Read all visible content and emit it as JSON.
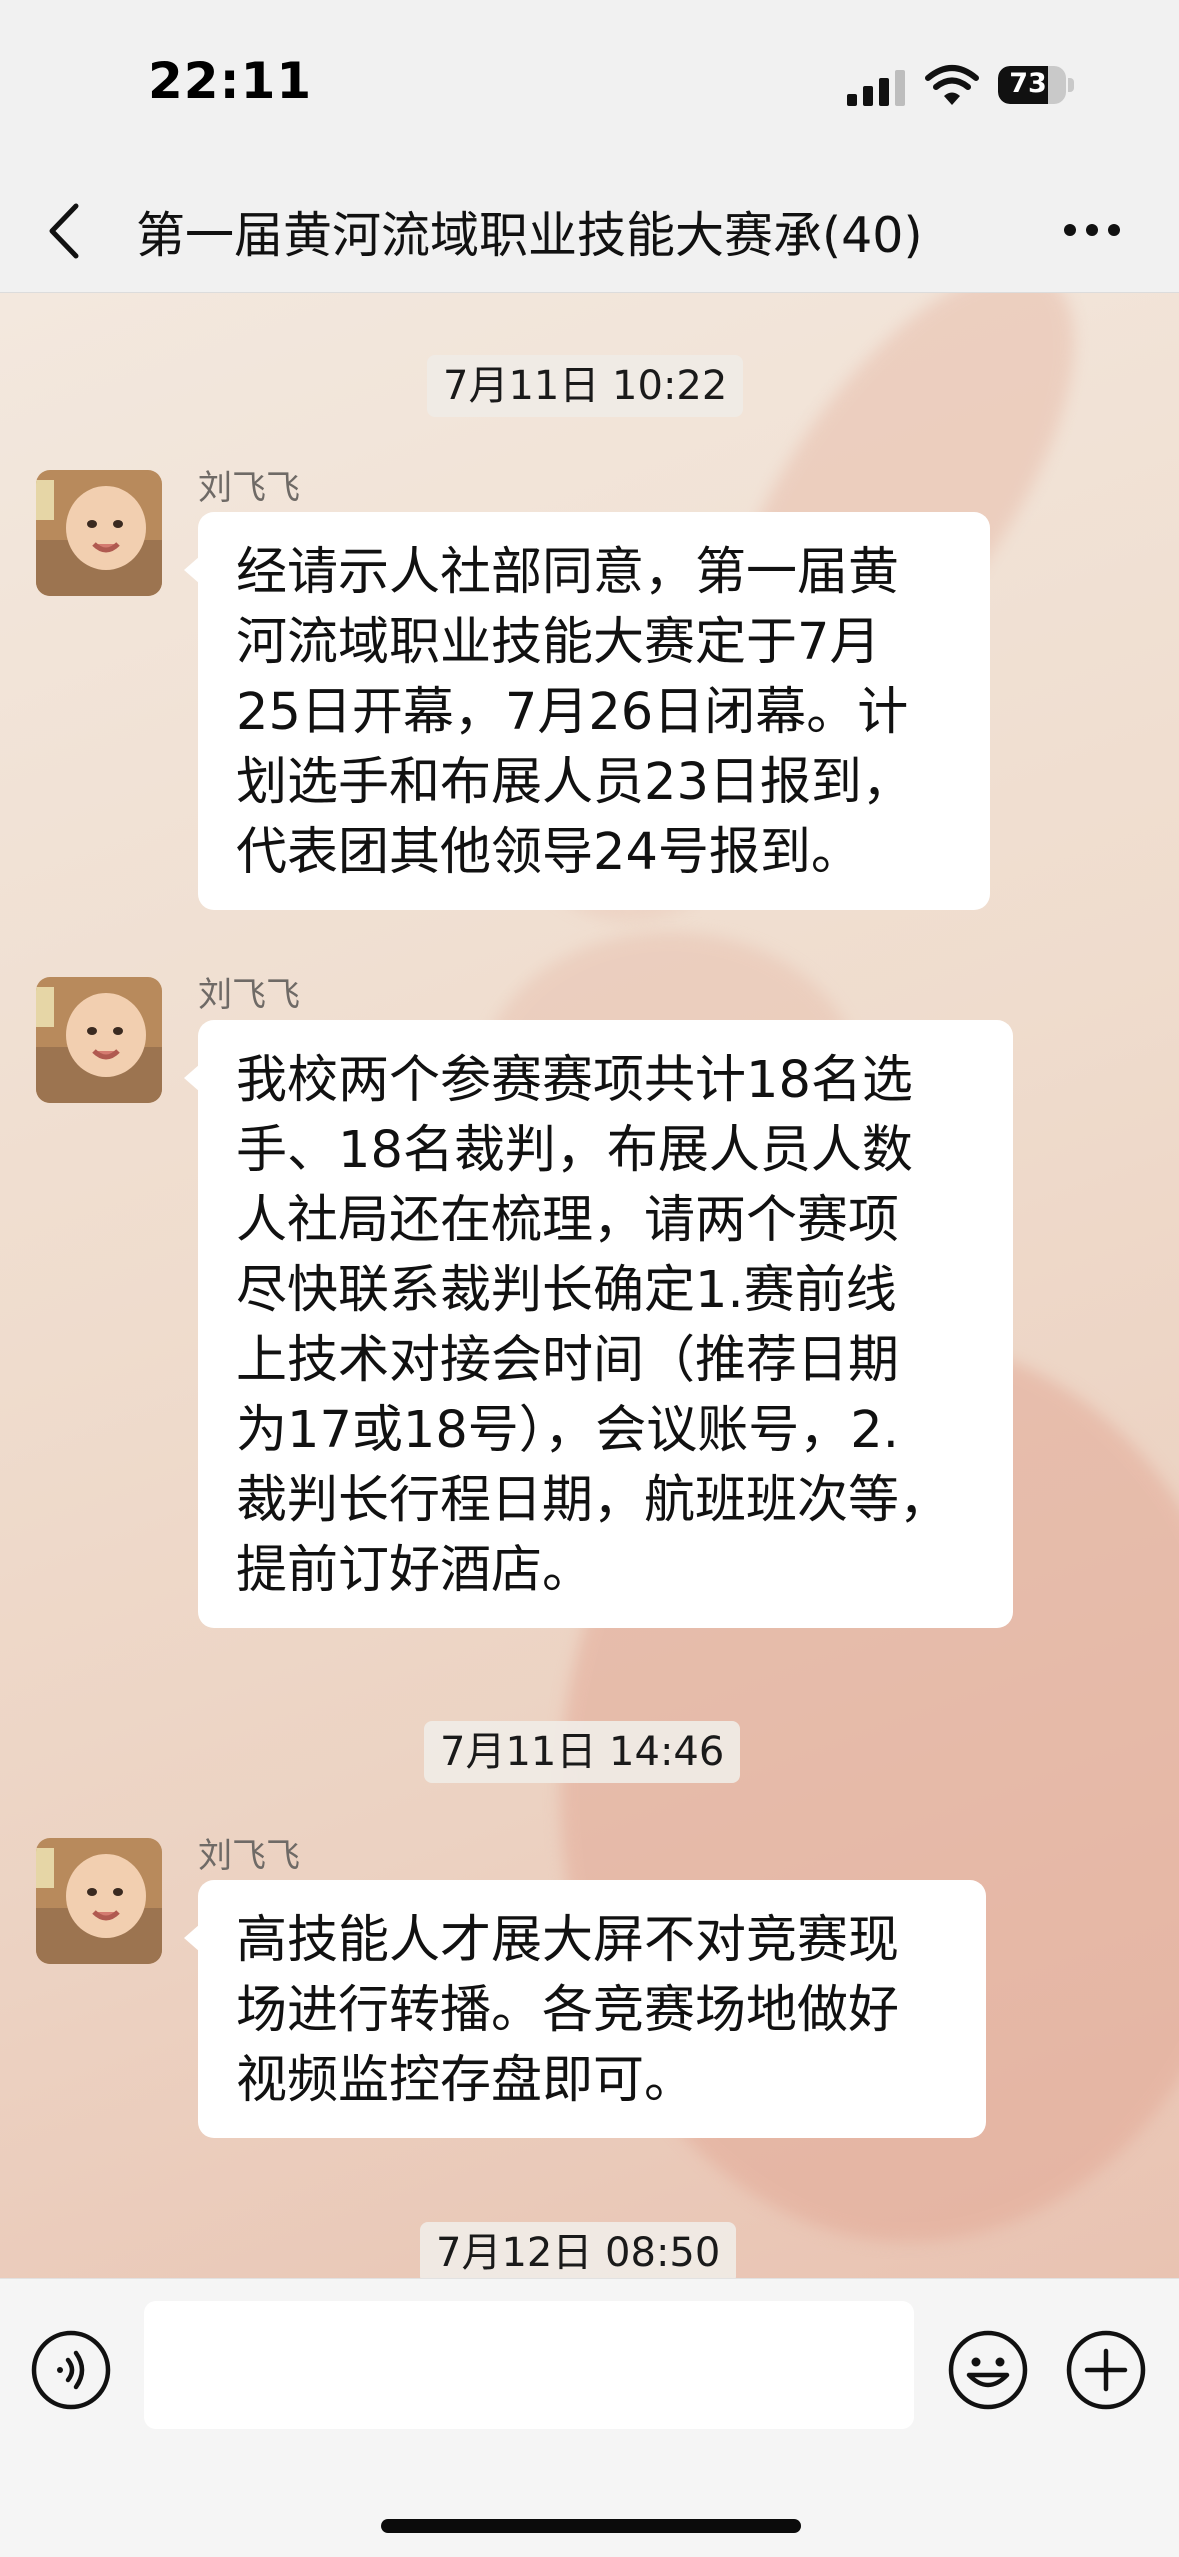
{
  "status_bar": {
    "time": "22:11",
    "battery": "73",
    "battery_level": 0.73
  },
  "nav": {
    "title": "第一届黄河流域职业技能大赛承(40)",
    "back_icon": "chevron-left-icon",
    "more_icon": "more-dots-icon"
  },
  "messages": {
    "chip1": "7月11日 10:22",
    "msg1": {
      "sender": "刘飞飞",
      "lines": [
        "经请示人社部同意，第一届黄",
        "河流域职业技能大赛定于7月",
        "25日开幕，7月26日闭幕。计",
        "划选手和布展人员23日报到，",
        "代表团其他领导24号报到。"
      ]
    },
    "msg2": {
      "sender": "刘飞飞",
      "lines": [
        "我校两个参赛赛项共计18名选",
        "手、18名裁判，布展人员人数",
        "人社局还在梳理，请两个赛项",
        "尽快联系裁判长确定1.赛前线",
        "上技术对接会时间（推荐日期",
        "为17或18号），会议账号，2.",
        "裁判长行程日期，航班班次等，",
        "提前订好酒店。"
      ]
    },
    "chip2": "7月11日 14:46",
    "msg3": {
      "sender": "刘飞飞",
      "lines": [
        "高技能人才展大屏不对竞赛现",
        "场进行转播。各竞赛场地做好",
        "视频监控存盘即可。"
      ]
    },
    "chip3": "7月12日 08:50"
  },
  "input_bar": {
    "voice_icon": "voice-icon",
    "emoji_icon": "emoji-icon",
    "plus_icon": "plus-circle-icon",
    "input_value": ""
  }
}
